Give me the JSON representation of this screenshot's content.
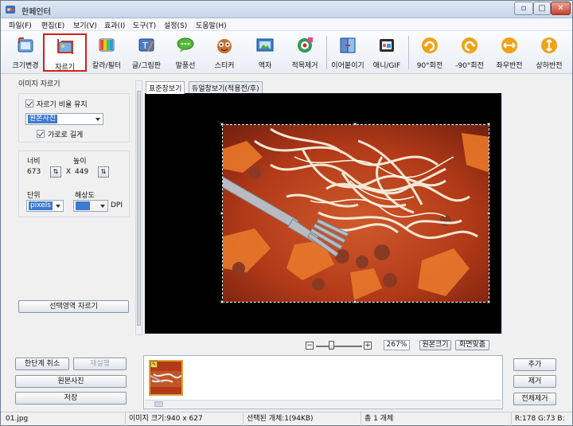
{
  "window": {
    "title": "한페인터",
    "controls": [
      "▫",
      "□",
      "✕"
    ]
  },
  "menu": [
    "파일(F)",
    "편집(E)",
    "보기(V)",
    "효과(I)",
    "도구(T)",
    "설정(S)",
    "도움말(H)"
  ],
  "toolbar": [
    {
      "label": "크기변경",
      "icon": "resize-icon"
    },
    {
      "label": "자르기",
      "icon": "crop-icon",
      "active": true
    },
    {
      "label": "칼라/필터",
      "icon": "color-filter-icon"
    },
    {
      "label": "글/그림판",
      "icon": "text-drawing-icon"
    },
    {
      "label": "말풍선",
      "icon": "speech-bubble-icon"
    },
    {
      "label": "스티커",
      "icon": "sticker-icon"
    },
    {
      "label": "액자",
      "icon": "frame-icon"
    },
    {
      "label": "적목제거",
      "icon": "red-eye-icon"
    },
    {
      "label": "이어붙이기",
      "icon": "join-icon"
    },
    {
      "label": "애니/GIF",
      "icon": "gif-icon"
    },
    {
      "label": "90°회전",
      "icon": "rotate-90-icon"
    },
    {
      "label": "-90°회전",
      "icon": "rotate-minus-90-icon"
    },
    {
      "label": "좌우반전",
      "icon": "flip-horizontal-icon"
    },
    {
      "label": "상하반전",
      "icon": "flip-vertical-icon"
    }
  ],
  "crop_panel": {
    "title": "이미지 자르기",
    "keep_ratio_label": "자르기 비율 유지",
    "keep_ratio_checked": true,
    "ratio_select": "원본사진",
    "landscape_label": "가로로 길게",
    "landscape_checked": true,
    "width_label": "너비",
    "width_value": "673",
    "height_label": "높이",
    "height_value": "449",
    "times": "X",
    "unit_label": "단위",
    "unit_value": "pixels",
    "resolution_label": "해상도",
    "resolution_value": "",
    "dpi_label": "DPI",
    "crop_button": "선택영역 자르기"
  },
  "tabs": [
    "표준창보기",
    "듀얼창보기(적용전/후)"
  ],
  "zoom": {
    "minus": "−",
    "plus": "+",
    "value": "267%",
    "level": 0.33,
    "original_button": "원본크기",
    "fit_button": "화면맞춤"
  },
  "actions_left": {
    "undo": "한단계 취소",
    "redo": "재실행",
    "original": "원본사진",
    "save": "저장"
  },
  "actions_right": {
    "add": "추가",
    "remove": "제거",
    "remove_all": "전체제거"
  },
  "status": {
    "file": "01.jpg",
    "image_size": "이미지 크기:940 x 627",
    "selected": "선택된 개체:1(94KB)",
    "total": "총 1 개체",
    "color": "R:178 G:73 B:"
  }
}
